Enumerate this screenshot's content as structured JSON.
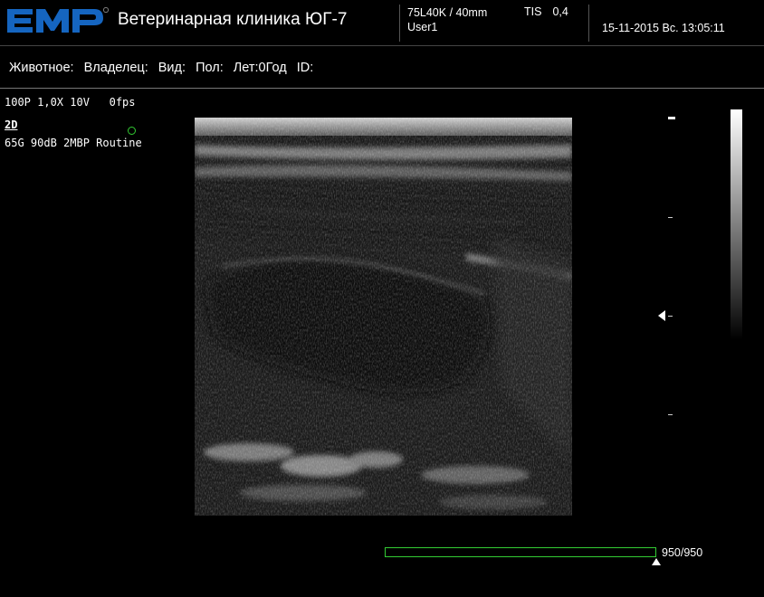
{
  "header": {
    "logo_text": "EMP",
    "clinic_name": "Ветеринарная клиника ЮГ-7",
    "probe": "75L40K / 40mm",
    "user": "User1",
    "tis_label": "TIS",
    "tis_value": "0,4",
    "datetime": "15-11-2015 Вс. 13:05:11"
  },
  "patient_info": {
    "animal": "Животное:",
    "owner": "Владелец:",
    "species": "Вид:",
    "sex": "Пол:",
    "age": "Лет:0Год",
    "id": "ID:"
  },
  "image_params": {
    "line1": "100P 1,0X 10V   0fps",
    "mode": "2D",
    "line2": "65G 90dB 2MBP Routine"
  },
  "cine": {
    "counter": "950/950",
    "progress": 1.0
  },
  "colors": {
    "brand_blue": "#1565c0",
    "status_green": "#33cc33"
  },
  "icons": {
    "status": "status-circle-icon",
    "focus": "focus-marker-icon",
    "cine_position": "cine-position-icon"
  }
}
